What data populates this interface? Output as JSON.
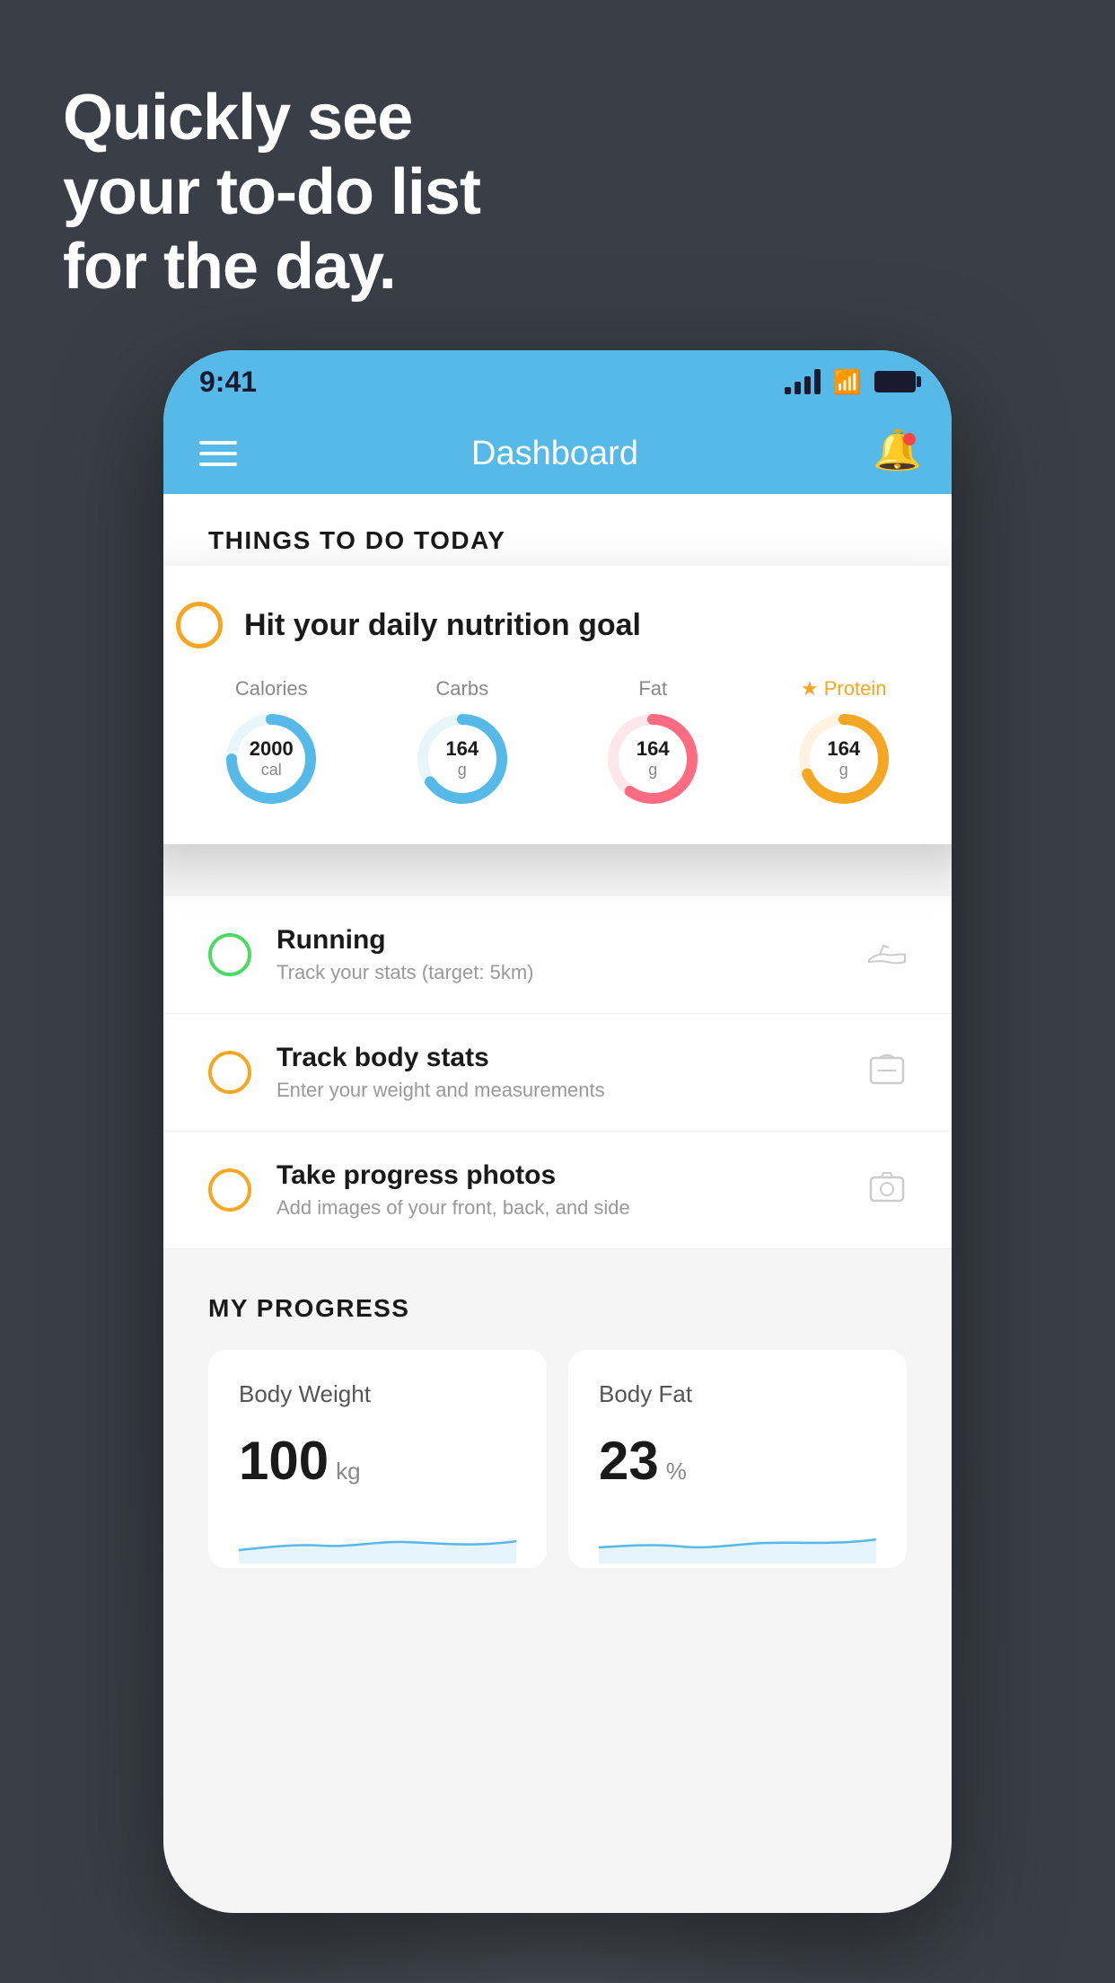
{
  "hero": {
    "line1": "Quickly see",
    "line2": "your to-do list",
    "line3": "for the day."
  },
  "status_bar": {
    "time": "9:41"
  },
  "nav": {
    "title": "Dashboard"
  },
  "section": {
    "things_to_do": "THINGS TO DO TODAY"
  },
  "floating_card": {
    "title": "Hit your daily nutrition goal",
    "nutrients": [
      {
        "label": "Calories",
        "value": "2000",
        "unit": "cal",
        "color": "#56b9e8",
        "starred": false
      },
      {
        "label": "Carbs",
        "value": "164",
        "unit": "g",
        "color": "#56b9e8",
        "starred": false
      },
      {
        "label": "Fat",
        "value": "164",
        "unit": "g",
        "color": "#ff6b81",
        "starred": false
      },
      {
        "label": "Protein",
        "value": "164",
        "unit": "g",
        "color": "#f5a623",
        "starred": true
      }
    ]
  },
  "todo_items": [
    {
      "title": "Running",
      "subtitle": "Track your stats (target: 5km)",
      "circle_color": "green",
      "icon": "shoe"
    },
    {
      "title": "Track body stats",
      "subtitle": "Enter your weight and measurements",
      "circle_color": "yellow",
      "icon": "scale"
    },
    {
      "title": "Take progress photos",
      "subtitle": "Add images of your front, back, and side",
      "circle_color": "yellow",
      "icon": "photo"
    }
  ],
  "progress": {
    "title": "MY PROGRESS",
    "cards": [
      {
        "title": "Body Weight",
        "value": "100",
        "unit": "kg"
      },
      {
        "title": "Body Fat",
        "value": "23",
        "unit": "%"
      }
    ]
  }
}
